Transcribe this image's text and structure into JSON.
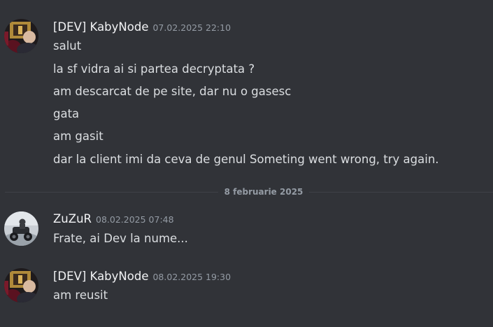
{
  "messages": [
    {
      "author": "[DEV] KabyNode",
      "timestamp": "07.02.2025 22:10",
      "avatar": "kabynode-avatar",
      "lines": [
        "salut",
        "la sf vidra ai si partea decryptata ?",
        "am descarcat de pe site, dar nu o gasesc",
        "gata",
        "am gasit",
        "dar la client imi da ceva de genul Someting went wrong, try again."
      ]
    },
    {
      "author": "ZuZuR",
      "timestamp": "08.02.2025 07:48",
      "avatar": "zuzur-avatar",
      "lines": [
        "Frate, ai Dev la nume..."
      ]
    },
    {
      "author": "[DEV] KabyNode",
      "timestamp": "08.02.2025 19:30",
      "avatar": "kabynode-avatar",
      "lines": [
        "am reusit"
      ]
    }
  ],
  "date_divider": "8 februarie 2025",
  "colors": {
    "background": "#313338",
    "username": "#f2f3f5",
    "message_text": "#dbdee1",
    "timestamp": "#949ba4",
    "divider": "#3f4147"
  }
}
